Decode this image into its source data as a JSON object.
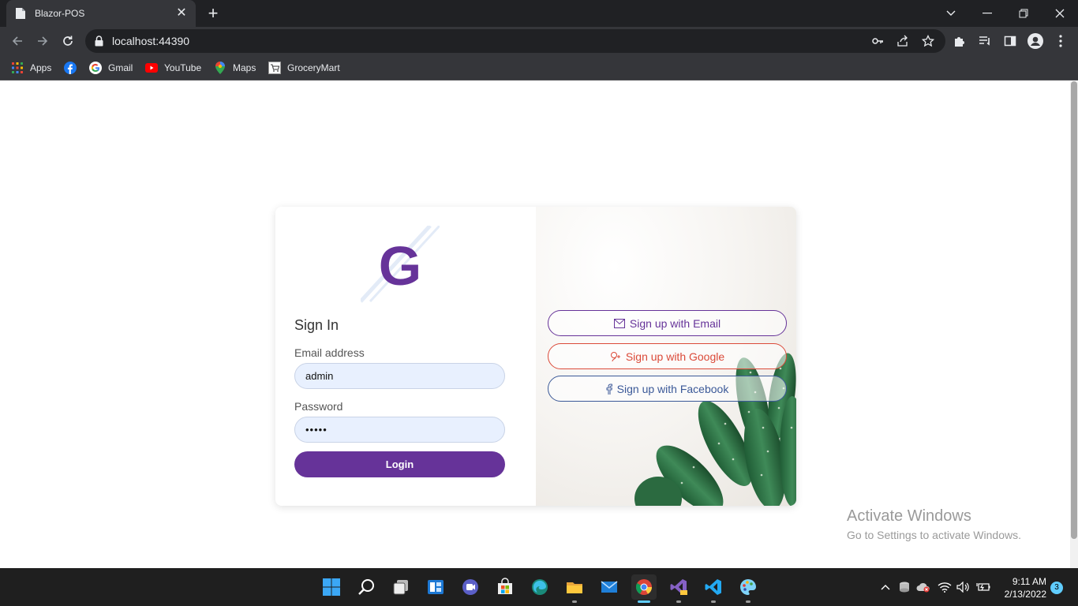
{
  "browser": {
    "tab_title": "Blazor-POS",
    "url": "localhost:44390",
    "bookmarks": [
      "Apps",
      "Gmail",
      "YouTube",
      "Maps",
      "GroceryMart"
    ]
  },
  "page": {
    "logo_letter": "G",
    "title": "Sign In",
    "email_label": "Email address",
    "email_value": "admin",
    "password_label": "Password",
    "password_value": "•••••",
    "login_label": "Login",
    "social": {
      "email": "Sign up with Email",
      "google": "Sign up with Google",
      "facebook": "Sign up with Facebook"
    },
    "colors": {
      "primary": "#663399",
      "google": "#db4a39",
      "facebook": "#3b5998"
    }
  },
  "watermark": {
    "line1": "Activate Windows",
    "line2": "Go to Settings to activate Windows."
  },
  "taskbar": {
    "time": "9:11 AM",
    "date": "2/13/2022",
    "notifications": "3",
    "apps": [
      "start-icon",
      "search-icon",
      "task-view-icon",
      "widgets-icon",
      "teams-chat-icon",
      "store-icon",
      "edge-icon",
      "file-explorer-icon",
      "mail-icon",
      "chrome-icon",
      "visual-studio-icon",
      "vscode-icon",
      "paint-icon"
    ]
  }
}
